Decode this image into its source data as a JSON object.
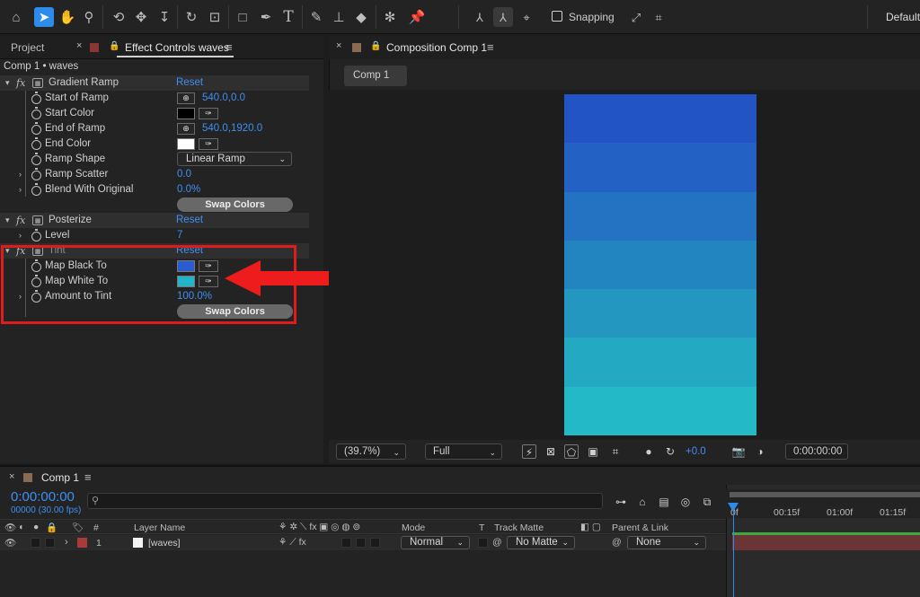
{
  "toolbar": {
    "snapping_label": "Snapping",
    "workspace_label": "Default"
  },
  "project_panel": {
    "tab_project": "Project",
    "tab_effect_controls": "Effect Controls waves",
    "breadcrumb": "Comp 1 • waves"
  },
  "effects": {
    "gradient_ramp": {
      "name": "Gradient Ramp",
      "reset": "Reset",
      "start_of_ramp_label": "Start of Ramp",
      "start_of_ramp_value": "540.0,0.0",
      "start_color_label": "Start Color",
      "start_color": "#000000",
      "end_of_ramp_label": "End of Ramp",
      "end_of_ramp_value": "540.0,1920.0",
      "end_color_label": "End Color",
      "end_color": "#ffffff",
      "ramp_shape_label": "Ramp Shape",
      "ramp_shape_value": "Linear Ramp",
      "ramp_scatter_label": "Ramp Scatter",
      "ramp_scatter_value": "0.0",
      "blend_label": "Blend With Original",
      "blend_value": "0.0%",
      "swap_colors": "Swap Colors"
    },
    "posterize": {
      "name": "Posterize",
      "reset": "Reset",
      "level_label": "Level",
      "level_value": "7"
    },
    "tint": {
      "name": "Tint",
      "reset": "Reset",
      "map_black_label": "Map Black To",
      "map_black_color": "#2a5bd0",
      "map_white_label": "Map White To",
      "map_white_color": "#22b4c8",
      "amount_label": "Amount to Tint",
      "amount_value": "100.0%",
      "swap_colors": "Swap Colors"
    }
  },
  "composition": {
    "tab_title": "Composition Comp 1",
    "subtab": "Comp 1",
    "bands": [
      "#2354c6",
      "#2362c4",
      "#2373c2",
      "#2385c0",
      "#2397bf",
      "#23a9c1",
      "#23b9c6"
    ],
    "zoom": "(39.7%)",
    "resolution": "Full",
    "exposure": "+0.0",
    "timecode": "0:00:00:00"
  },
  "timeline": {
    "tab_title": "Comp 1",
    "timecode": "0:00:00:00",
    "fps": "00000 (30.00 fps)",
    "columns": {
      "number": "#",
      "layer_name": "Layer Name",
      "mode": "Mode",
      "t": "T",
      "track_matte": "Track Matte",
      "parent": "Parent & Link"
    },
    "ruler": [
      "0f",
      "00:15f",
      "01:00f",
      "01:15f"
    ],
    "layer": {
      "index": "1",
      "name": "[waves]",
      "mode": "Normal",
      "matte": "No Matte",
      "parent": "None"
    }
  },
  "icons": {
    "toolbar": [
      "home-icon",
      "selection-tool-icon",
      "hand-tool-icon",
      "zoom-tool-icon",
      "orbit-camera-icon",
      "pan-camera-icon",
      "dolly-camera-icon",
      "rotate-tool-icon",
      "pan-behind-icon",
      "rectangle-tool-icon",
      "pen-tool-icon",
      "type-tool-icon",
      "brush-tool-icon",
      "clone-stamp-icon",
      "eraser-icon",
      "roto-brush-icon",
      "puppet-pin-icon"
    ]
  }
}
